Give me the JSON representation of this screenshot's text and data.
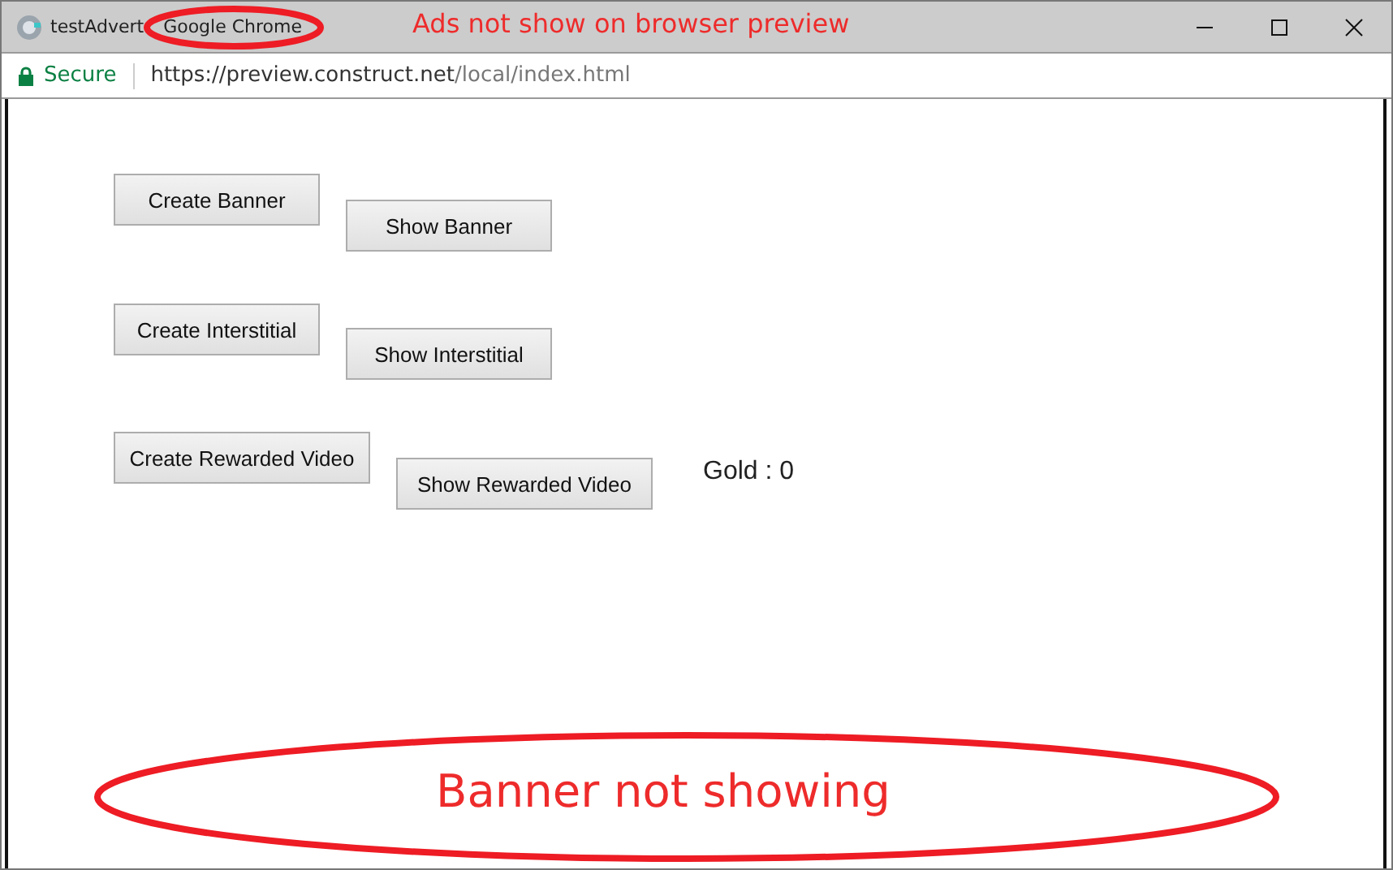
{
  "window": {
    "title": "testAdvert",
    "browser": "Google Chrome"
  },
  "address_bar": {
    "security": "Secure",
    "url_host": "https://preview.construct.net",
    "url_path": "/local/index.html"
  },
  "game": {
    "buttons": [
      {
        "label": "Create Banner"
      },
      {
        "label": "Show Banner"
      },
      {
        "label": "Create Interstitial"
      },
      {
        "label": "Show Interstitial"
      },
      {
        "label": "Create Rewarded Video"
      },
      {
        "label": "Show Rewarded Video"
      }
    ],
    "gold": "Gold : 0"
  },
  "annotations": [
    {
      "kind": "title-ring"
    },
    {
      "kind": "note",
      "text": "Ads not show on browser preview"
    },
    {
      "kind": "ellipse",
      "text": "Banner not showing"
    }
  ]
}
